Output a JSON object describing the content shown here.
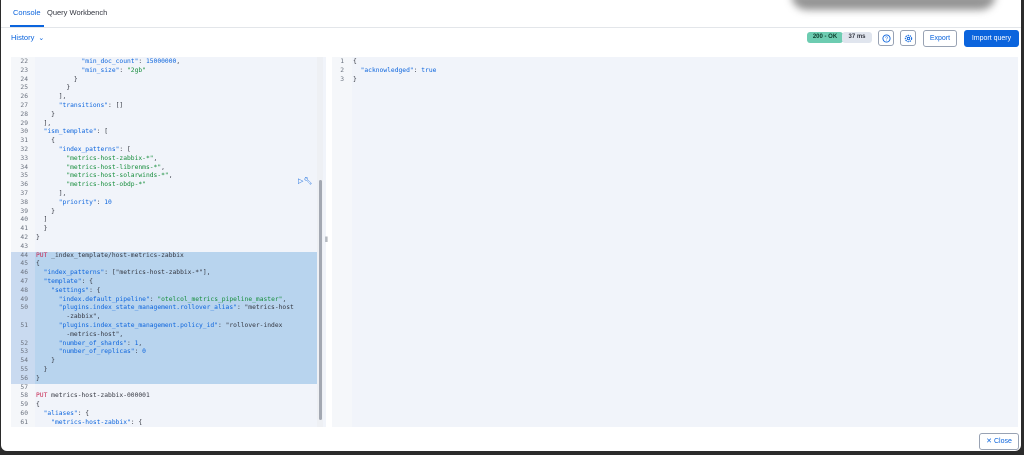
{
  "tabs": [
    {
      "label": "Console"
    },
    {
      "label": "Query Workbench"
    }
  ],
  "history": {
    "label": "History"
  },
  "status": {
    "code": "200 - OK",
    "time": "37 ms"
  },
  "buttons": {
    "export": "Export",
    "import": "Import query",
    "close": "Close"
  },
  "icons": {
    "help": "question-circle-icon",
    "settings": "gear-icon",
    "run": "play-icon",
    "wrench": "wrench-icon",
    "close": "cross-icon",
    "chevron": "chevron-down-icon"
  },
  "colors": {
    "accent": "#0b64dd",
    "ok_badge": "#6dccb1",
    "selection": "#b8d4ee"
  },
  "editor_lines": [
    {
      "n": "22",
      "t": "            \"min_doc_count\": 15000000,"
    },
    {
      "n": "23",
      "t": "            \"min_size\": \"2gb\""
    },
    {
      "n": "24",
      "t": "          }"
    },
    {
      "n": "25",
      "t": "        }"
    },
    {
      "n": "26",
      "t": "      ],"
    },
    {
      "n": "27",
      "t": "      \"transitions\": []"
    },
    {
      "n": "28",
      "t": "    }"
    },
    {
      "n": "29",
      "t": "  ],"
    },
    {
      "n": "30",
      "t": "  \"ism_template\": ["
    },
    {
      "n": "31",
      "t": "    {"
    },
    {
      "n": "32",
      "t": "      \"index_patterns\": ["
    },
    {
      "n": "33",
      "t": "        \"metrics-host-zabbix-*\","
    },
    {
      "n": "34",
      "t": "        \"metrics-host-librenms-*\","
    },
    {
      "n": "35",
      "t": "        \"metrics-host-solarwinds-*\","
    },
    {
      "n": "36",
      "t": "        \"metrics-host-obdp-*\""
    },
    {
      "n": "37",
      "t": "      ],"
    },
    {
      "n": "38",
      "t": "      \"priority\": 10"
    },
    {
      "n": "39",
      "t": "    }"
    },
    {
      "n": "40",
      "t": "  ]"
    },
    {
      "n": "41",
      "t": "  }"
    },
    {
      "n": "42",
      "t": "}"
    },
    {
      "n": "43",
      "t": ""
    },
    {
      "n": "44",
      "t": "PUT _index_template/host-metrics-zabbix"
    },
    {
      "n": "45",
      "t": "{"
    },
    {
      "n": "46",
      "t": "  \"index_patterns\": [\"metrics-host-zabbix-*\"],"
    },
    {
      "n": "47",
      "t": "  \"template\": {"
    },
    {
      "n": "48",
      "t": "    \"settings\": {"
    },
    {
      "n": "49",
      "t": "      \"index.default_pipeline\": \"otelcol_metrics_pipeline_master\","
    },
    {
      "n": "50",
      "t": "      \"plugins.index_state_management.rollover_alias\": \"metrics-host"
    },
    {
      "n": "",
      "t": "        -zabbix\","
    },
    {
      "n": "51",
      "t": "      \"plugins.index_state_management.policy_id\": \"rollover-index"
    },
    {
      "n": "",
      "t": "        -metrics-host\","
    },
    {
      "n": "52",
      "t": "      \"number_of_shards\": 1,"
    },
    {
      "n": "53",
      "t": "      \"number_of_replicas\": 0"
    },
    {
      "n": "54",
      "t": "    }"
    },
    {
      "n": "55",
      "t": "  }"
    },
    {
      "n": "56",
      "t": "}"
    },
    {
      "n": "57",
      "t": ""
    },
    {
      "n": "58",
      "t": "PUT metrics-host-zabbix-000001"
    },
    {
      "n": "59",
      "t": "{"
    },
    {
      "n": "60",
      "t": "  \"aliases\": {"
    },
    {
      "n": "61",
      "t": "    \"metrics-host-zabbix\": {"
    },
    {
      "n": "62",
      "t": "      \"is_write_index\": true"
    },
    {
      "n": "63",
      "t": "    }"
    },
    {
      "n": "64",
      "t": "  }"
    },
    {
      "n": "65",
      "t": "}"
    }
  ],
  "output_lines": [
    {
      "n": "1",
      "t": "{"
    },
    {
      "n": "2",
      "t": "  \"acknowledged\": true"
    },
    {
      "n": "3",
      "t": "}"
    }
  ]
}
